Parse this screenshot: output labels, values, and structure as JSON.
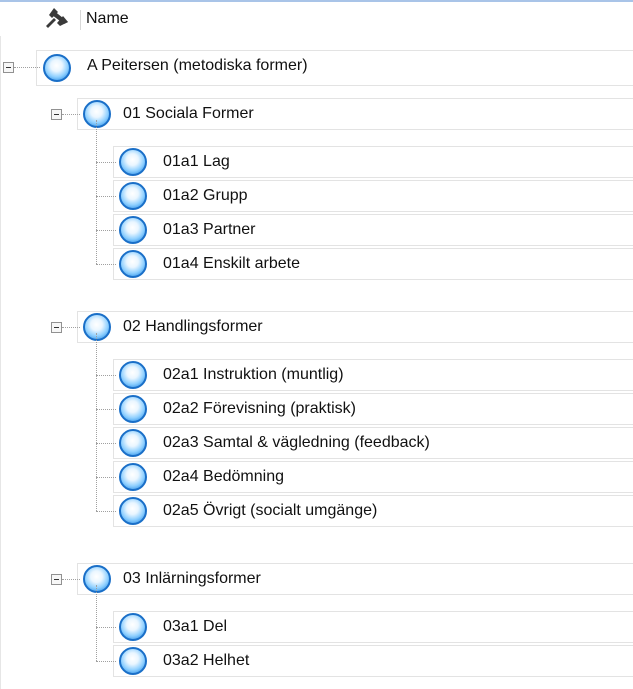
{
  "header": {
    "column_name": "Name",
    "pin_icon": "pin-icon"
  },
  "tree": {
    "root": {
      "label": "A Peitersen (metodiska former)",
      "icon": "blue-orb-icon",
      "expanded": true
    },
    "groups": [
      {
        "label": "01 Sociala Former",
        "icon": "blue-orb-icon",
        "expanded": true,
        "children": [
          {
            "label": "01a1 Lag",
            "icon": "blue-orb-icon"
          },
          {
            "label": "01a2 Grupp",
            "icon": "blue-orb-icon"
          },
          {
            "label": "01a3 Partner",
            "icon": "blue-orb-icon"
          },
          {
            "label": "01a4 Enskilt arbete",
            "icon": "blue-orb-icon"
          }
        ]
      },
      {
        "label": "02 Handlingsformer",
        "icon": "blue-orb-icon",
        "expanded": true,
        "children": [
          {
            "label": "02a1 Instruktion (muntlig)",
            "icon": "blue-orb-icon"
          },
          {
            "label": "02a2 Förevisning (praktisk)",
            "icon": "blue-orb-icon"
          },
          {
            "label": "02a3 Samtal & vägledning (feedback)",
            "icon": "blue-orb-icon"
          },
          {
            "label": "02a4 Bedömning",
            "icon": "blue-orb-icon"
          },
          {
            "label": "02a5 Övrigt (socialt umgänge)",
            "icon": "blue-orb-icon"
          }
        ]
      },
      {
        "label": "03 Inlärningsformer",
        "icon": "blue-orb-icon",
        "expanded": true,
        "children": [
          {
            "label": "03a1 Del",
            "icon": "blue-orb-icon"
          },
          {
            "label": "03a2 Helhet",
            "icon": "blue-orb-icon"
          }
        ]
      }
    ]
  },
  "colors": {
    "header_border": "#a9c4e8",
    "row_border": "#e3e3e3",
    "tree_line": "#a0a0a0",
    "orb_ring": "#1a6fc8"
  }
}
